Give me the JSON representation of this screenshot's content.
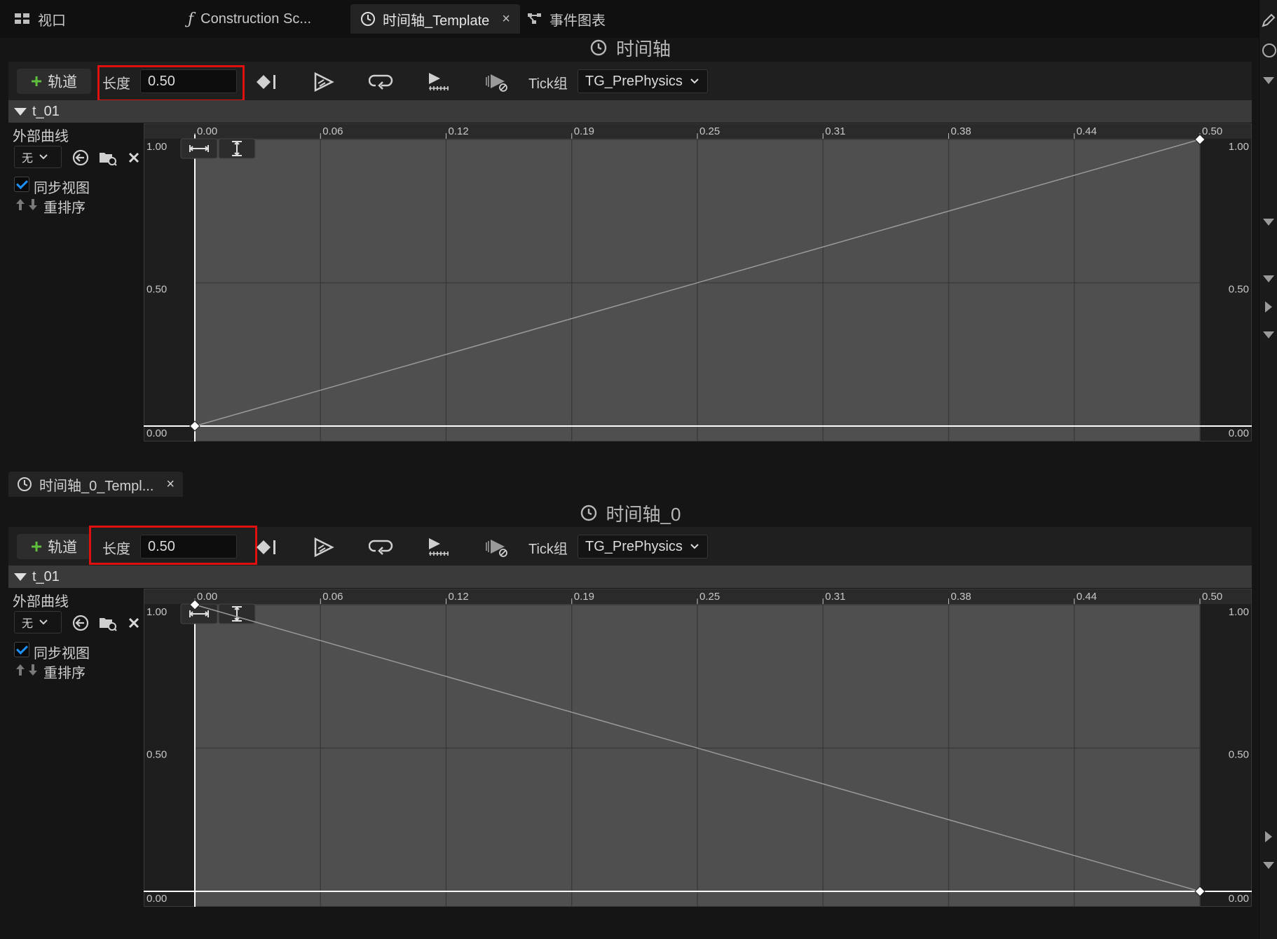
{
  "tabs": [
    {
      "label": "视口",
      "icon": "viewport-grid-icon"
    },
    {
      "label": "Construction Sc...",
      "icon": "function-icon"
    },
    {
      "label": "时间轴_Template",
      "icon": "clock-icon",
      "active": true,
      "close": "×"
    },
    {
      "label": "事件图表",
      "icon": "event-graph-icon"
    }
  ],
  "panels": [
    {
      "title": "时间轴",
      "toolbar": {
        "add_track": "轨道",
        "length_label": "长度",
        "length_value": "0.50",
        "tick_label": "Tick组",
        "tick_value": "TG_PrePhysics"
      },
      "track": {
        "name": "t_01",
        "external_curve": "外部曲线",
        "curve_select": "无",
        "sync_view": "同步视图",
        "sync_checked": true,
        "reorder": "重排序"
      },
      "curve": {
        "x_ticks": [
          "0.00",
          "0.06",
          "0.12",
          "0.19",
          "0.25",
          "0.31",
          "0.38",
          "0.44",
          "0.50"
        ],
        "y_ticks": [
          "1.00",
          "0.50",
          "0.00"
        ],
        "keys": [
          {
            "t": 0.0,
            "v": 0.0
          },
          {
            "t": 0.5,
            "v": 1.0
          }
        ],
        "x_range": [
          0.0,
          0.5
        ],
        "y_range": [
          0.0,
          1.0
        ]
      }
    },
    {
      "tab": {
        "label": "时间轴_0_Templ...",
        "close": "×"
      },
      "title": "时间轴_0",
      "toolbar": {
        "add_track": "轨道",
        "length_label": "长度",
        "length_value": "0.50",
        "tick_label": "Tick组",
        "tick_value": "TG_PrePhysics"
      },
      "track": {
        "name": "t_01",
        "external_curve": "外部曲线",
        "curve_select": "无",
        "sync_view": "同步视图",
        "sync_checked": true,
        "reorder": "重排序"
      },
      "curve": {
        "x_ticks": [
          "0.00",
          "0.06",
          "0.12",
          "0.19",
          "0.25",
          "0.31",
          "0.38",
          "0.44",
          "0.50"
        ],
        "y_ticks": [
          "1.00",
          "0.50",
          "0.00"
        ],
        "keys": [
          {
            "t": 0.0,
            "v": 1.0
          },
          {
            "t": 0.5,
            "v": 0.0
          }
        ],
        "x_range": [
          0.0,
          0.5
        ],
        "y_range": [
          0.0,
          1.0
        ]
      }
    }
  ],
  "colors": {
    "highlight_box": "#e01010",
    "add_plus": "#5fbf3d",
    "checkbox": "#1e90ff",
    "graph_bg": "#4f4f4f",
    "graph_outside": "#1e1e1e"
  }
}
